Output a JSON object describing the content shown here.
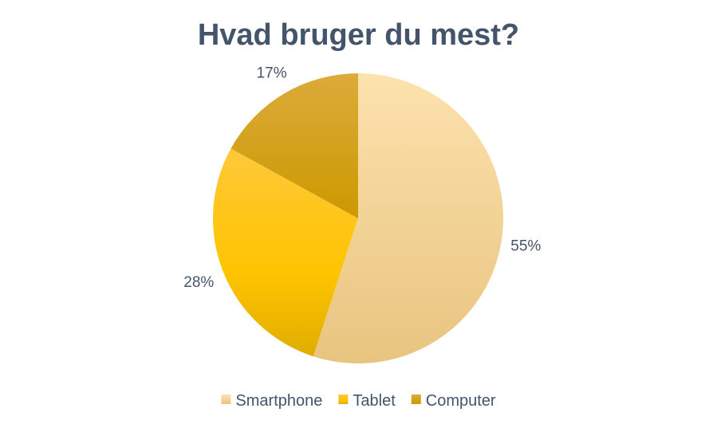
{
  "chart_data": {
    "type": "pie",
    "title": "Hvad bruger du mest?",
    "categories": [
      "Smartphone",
      "Tablet",
      "Computer"
    ],
    "values": [
      55,
      28,
      17
    ],
    "data_labels": [
      "55%",
      "28%",
      "17%"
    ],
    "colors": [
      "#fbd99a",
      "#ffc000",
      "#d4a017"
    ],
    "start_angle_deg": 0,
    "direction": "clockwise",
    "legend_position": "bottom"
  }
}
